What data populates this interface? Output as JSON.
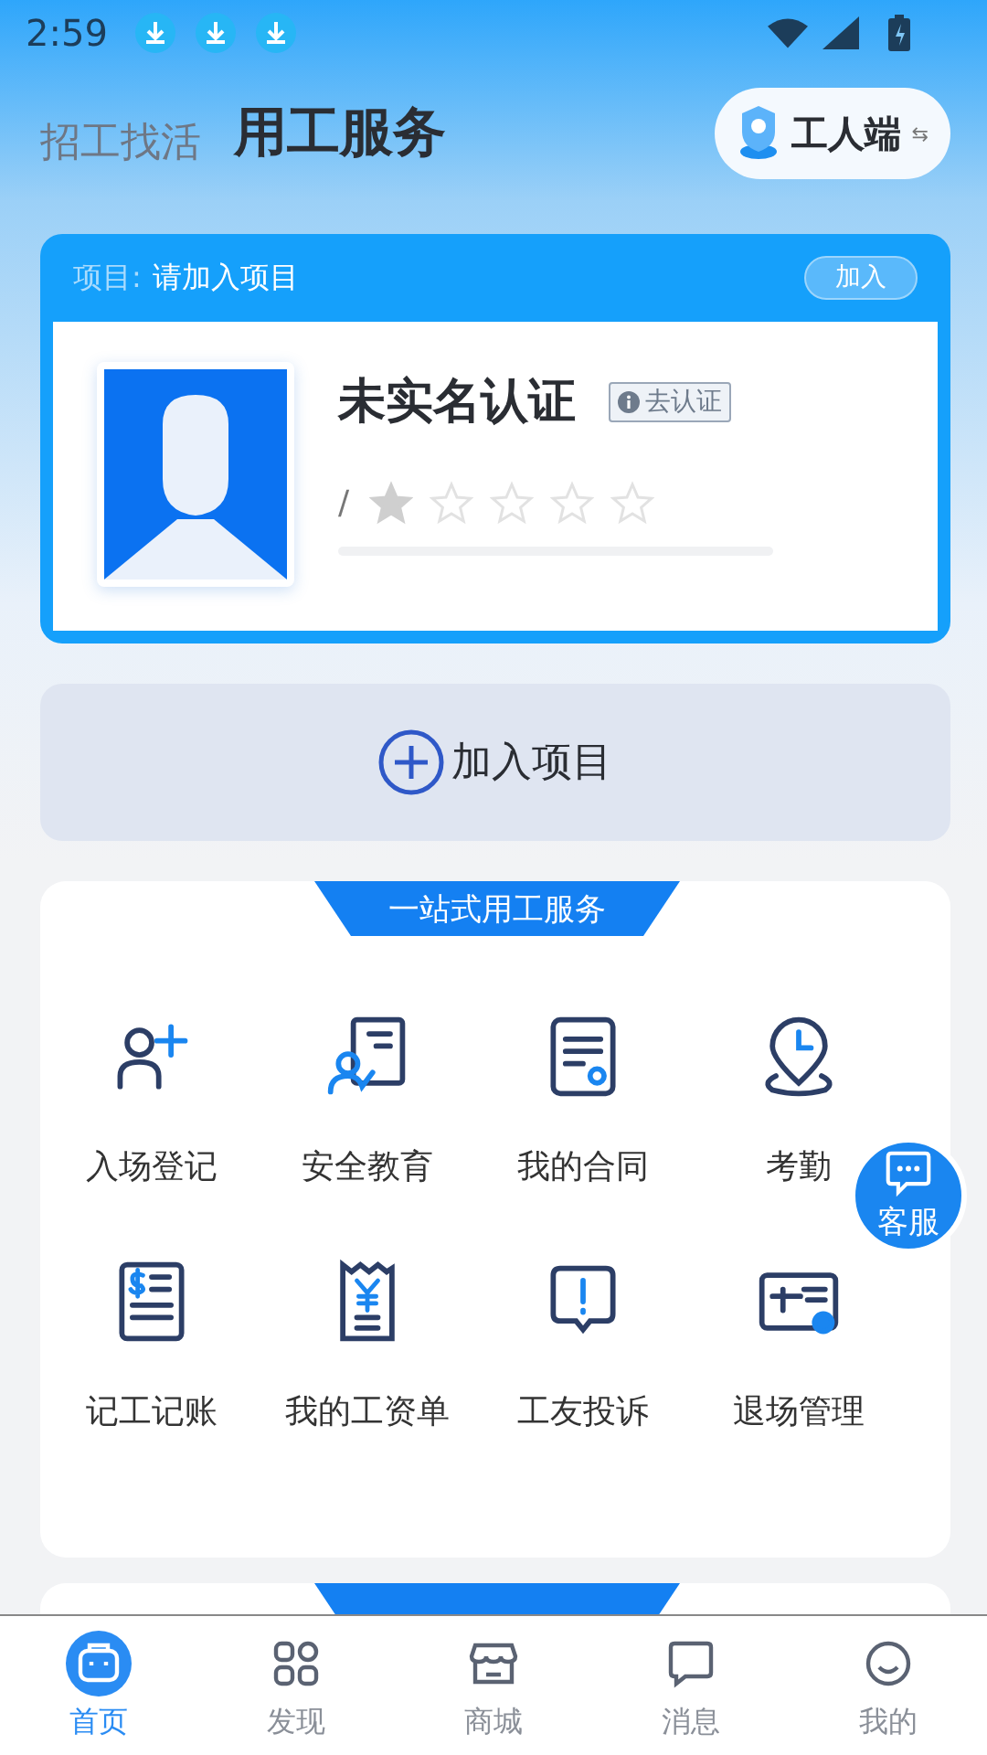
{
  "status_bar": {
    "time": "2:59"
  },
  "header": {
    "tabs": [
      {
        "label": "招工找活",
        "selected": false
      },
      {
        "label": "用工服务",
        "selected": true
      }
    ],
    "role_switch": "工人端",
    "switch_mark": "⇆"
  },
  "profile_card": {
    "project_label": "项目:",
    "project_value": "请加入项目",
    "join_button": "加入",
    "name": "未实名认证",
    "verify_button": "去认证",
    "rating_prefix": "/",
    "stars": 1,
    "level": 0
  },
  "join_project": {
    "label": "加入项目"
  },
  "services": {
    "title": "一站式用工服务",
    "items": [
      {
        "label": "入场登记"
      },
      {
        "label": "安全教育"
      },
      {
        "label": "我的合同"
      },
      {
        "label": "考勤"
      },
      {
        "label": "记工记账"
      },
      {
        "label": "我的工资单"
      },
      {
        "label": "工友投诉"
      },
      {
        "label": "退场管理"
      }
    ]
  },
  "support_button": {
    "label": "客服"
  },
  "bottom_nav": [
    {
      "label": "首页",
      "selected": true
    },
    {
      "label": "发现",
      "selected": false
    },
    {
      "label": "商城",
      "selected": false
    },
    {
      "label": "消息",
      "selected": false
    },
    {
      "label": "我的",
      "selected": false
    }
  ]
}
